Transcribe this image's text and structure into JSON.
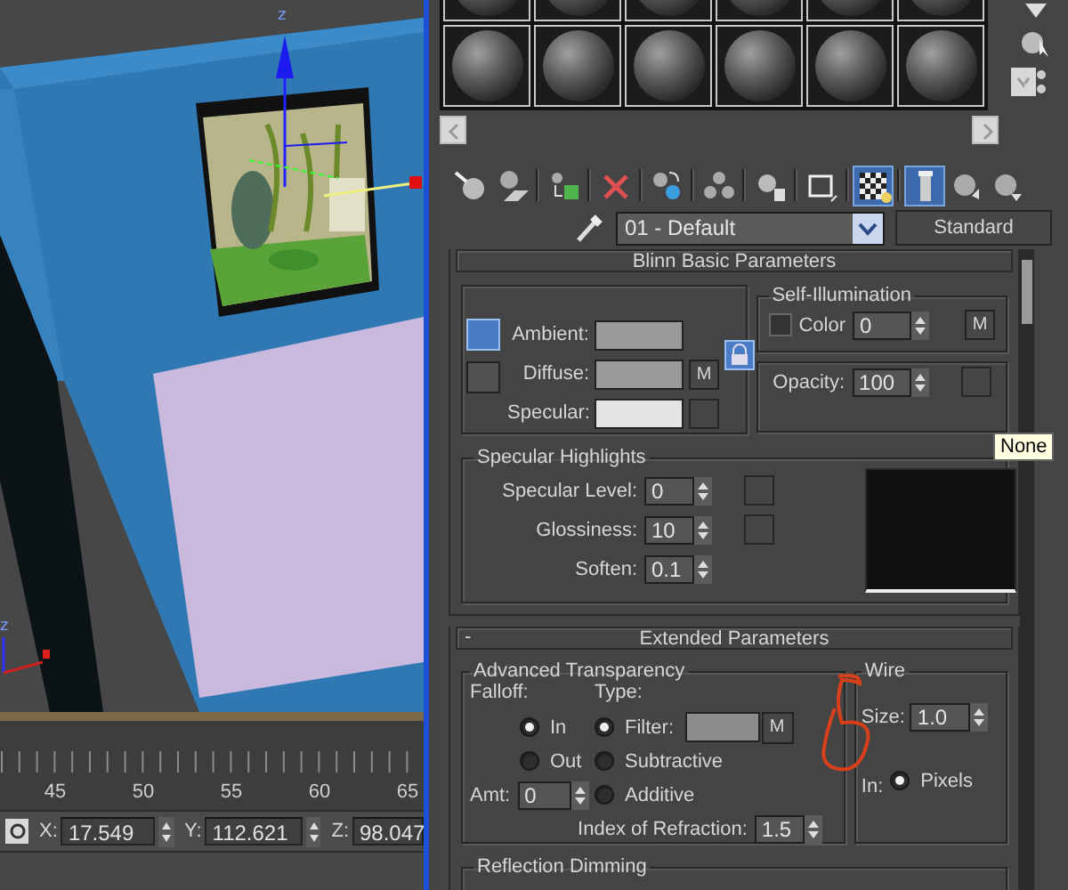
{
  "viewport": {
    "gizmo_axis": "z",
    "corner_axis": "z"
  },
  "timeline": {
    "ticks": [
      "45",
      "50",
      "55",
      "60",
      "65"
    ]
  },
  "coordinates": [
    {
      "label": "X:",
      "value": "17.549"
    },
    {
      "label": "Y:",
      "value": "112.621"
    },
    {
      "label": "Z:",
      "value": "98.047"
    }
  ],
  "material_editor": {
    "toolbar": [
      {
        "kind": "get",
        "selected": false
      },
      {
        "kind": "put",
        "selected": false
      },
      {
        "kind": "assign",
        "selected": false
      },
      {
        "kind": "delete",
        "selected": false
      },
      {
        "kind": "unique",
        "selected": false
      },
      {
        "kind": "copy",
        "selected": false
      },
      {
        "kind": "library",
        "selected": false
      },
      {
        "kind": "channel",
        "selected": false
      },
      {
        "kind": "checker",
        "selected": true
      },
      {
        "kind": "showmap",
        "selected": true
      },
      {
        "kind": "parent",
        "selected": false
      },
      {
        "kind": "sibling",
        "selected": false
      }
    ],
    "material_name": "01 - Default",
    "material_type": "Standard",
    "basic_rollout": {
      "title": "Blinn Basic Parameters",
      "shading_buttons": [
        {
          "selected": true
        },
        {
          "selected": false
        }
      ],
      "lock_on": true,
      "colors": [
        {
          "label": "Ambient:",
          "color": "#9a9a9a",
          "kind": "lock"
        },
        {
          "label": "Diffuse:",
          "color": "#9a9a9a",
          "kind": "map",
          "map": "M"
        },
        {
          "label": "Specular:",
          "color": "#e4e4e4",
          "kind": "slot"
        }
      ],
      "self_illumination": {
        "title": "Self-Illumination",
        "checked": false,
        "label": "Color",
        "value": "0",
        "map": "M"
      },
      "opacity": {
        "label": "Opacity:",
        "value": "100"
      },
      "specular_highlights": {
        "title": "Specular Highlights",
        "fields": [
          {
            "label": "Specular Level:",
            "value": "0",
            "slot": true
          },
          {
            "label": "Glossiness:",
            "value": "10",
            "slot": true
          },
          {
            "label": "Soften:",
            "value": "0.1",
            "slot": false
          }
        ]
      }
    },
    "extended_rollout": {
      "toggle": "-",
      "title": "Extended Parameters",
      "advanced_transparency": {
        "title": "Advanced Transparency",
        "falloff_label": "Falloff:",
        "falloff": [
          {
            "label": "In",
            "selected": true
          },
          {
            "label": "Out",
            "selected": false
          }
        ],
        "amt_label": "Amt:",
        "amt": "0",
        "type_label": "Type:",
        "types": [
          {
            "label": "Filter:",
            "selected": true,
            "color": "#8c8c8c",
            "map": "M"
          },
          {
            "label": "Subtractive",
            "selected": false
          },
          {
            "label": "Additive",
            "selected": false
          }
        ],
        "refraction_label": "Index of Refraction:",
        "refraction": "1.5"
      },
      "wire": {
        "title": "Wire",
        "size_label": "Size:",
        "size": "1.0",
        "in_label": "In:",
        "units": [
          {
            "label": "Pixels",
            "selected": true
          }
        ]
      }
    },
    "next_rollout": "Reflection Dimming",
    "tooltip": "None"
  }
}
